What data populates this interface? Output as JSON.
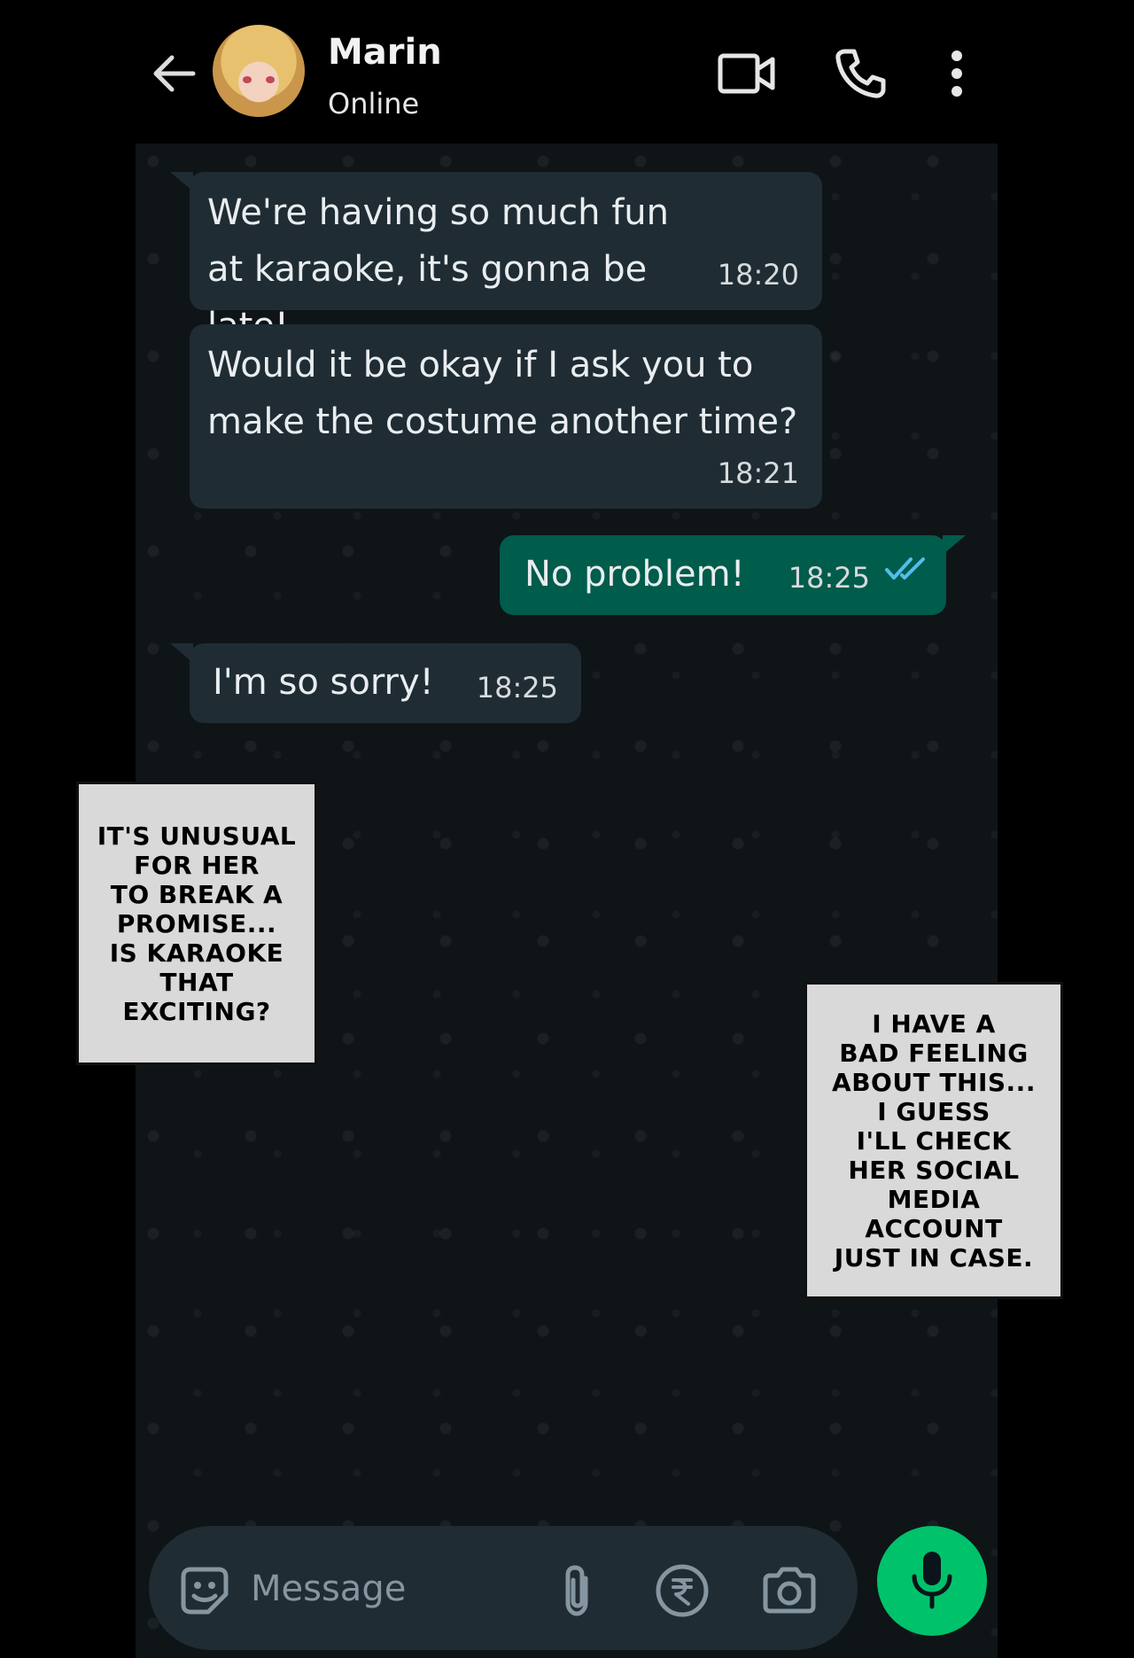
{
  "header": {
    "contact_name": "Marin",
    "status": "Online",
    "icons": [
      "back-arrow-icon",
      "video-call-icon",
      "phone-icon",
      "more-options-icon"
    ]
  },
  "messages": [
    {
      "direction": "incoming",
      "text": "We're having so much fun at karaoke, it's gonna be late!",
      "time": "18:20"
    },
    {
      "direction": "incoming",
      "text": "Would it be okay if I ask you to make the costume another time?",
      "time": "18:21"
    },
    {
      "direction": "outgoing",
      "text": "No problem!",
      "time": "18:25",
      "read": true
    },
    {
      "direction": "incoming",
      "text": "I'm so sorry!",
      "time": "18:25"
    }
  ],
  "captions": [
    {
      "text": "It's unusual\nfor her\nto break a\npromise...\nis karaoke\nthat\nexciting?"
    },
    {
      "text": "I have a\nbad feeling\nabout this...\nI guess\nI'll check\nher social\nmedia\naccount\njust in case."
    }
  ],
  "input": {
    "placeholder": "Message",
    "icons": [
      "sticker-icon",
      "attach-icon",
      "rupee-payment-icon",
      "camera-icon",
      "microphone-icon"
    ]
  },
  "colors": {
    "incoming_bubble": "#1f2c33",
    "outgoing_bubble": "#005c4b",
    "mic_button": "#00c26b",
    "read_ticks": "#53bdeb"
  }
}
